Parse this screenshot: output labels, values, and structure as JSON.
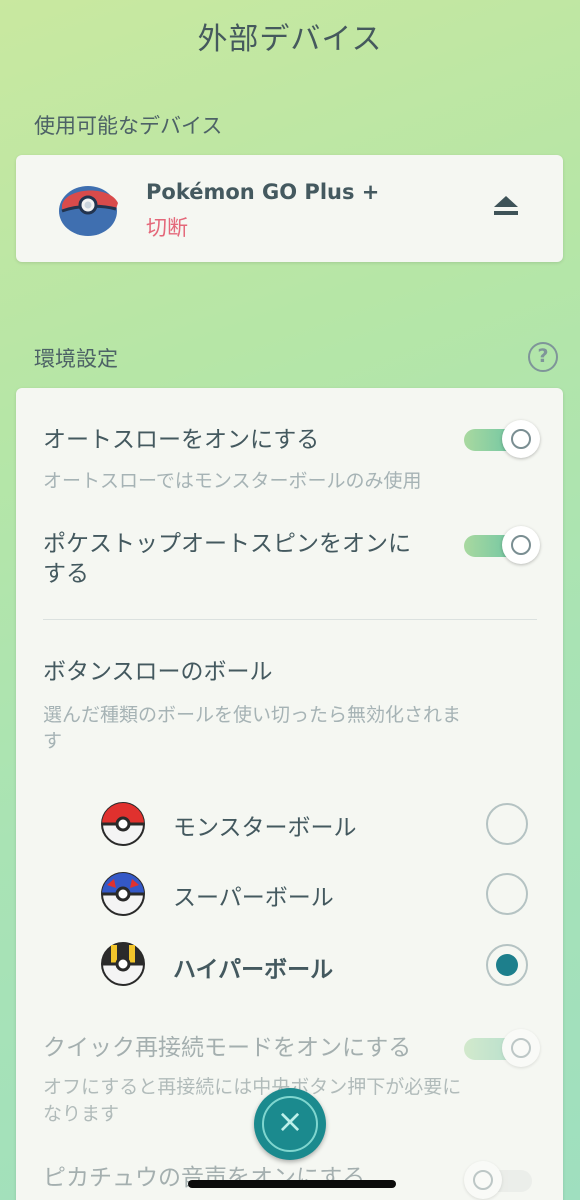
{
  "header": {
    "title": "外部デバイス"
  },
  "devices": {
    "section_label": "使用可能なデバイス",
    "device": {
      "name": "Pokémon GO Plus +",
      "status": "切断",
      "status_color": "#e4687a",
      "action_icon": "eject-icon"
    }
  },
  "settings": {
    "section_label": "環境設定",
    "help_icon": "?",
    "auto_throw": {
      "title": "オートスローをオンにする",
      "description": "オートスローではモンスターボールのみ使用",
      "enabled": true
    },
    "auto_spin": {
      "title_line1": "ポケストップオートスピンをオンに",
      "title_line2": "する",
      "enabled": true
    },
    "button_throw": {
      "title": "ボタンスローのボール",
      "description_line1": "選んだ種類のボールを使い切ったら無効化されま",
      "description_line2": "す",
      "balls": [
        {
          "label": "モンスターボール",
          "icon": "poke-ball-icon",
          "selected": false
        },
        {
          "label": "スーパーボール",
          "icon": "great-ball-icon",
          "selected": false
        },
        {
          "label": "ハイパーボール",
          "icon": "ultra-ball-icon",
          "selected": true
        }
      ]
    },
    "quick_reconnect": {
      "title": "クイック再接続モードをオンにする",
      "description_line1": "オフにすると再接続には中央ボタン押下が必要に",
      "description_line2": "なります",
      "enabled": true
    },
    "pikachu_voice": {
      "title": "ピカチュウの音声をオンにする",
      "enabled": false
    }
  },
  "footer": {
    "close_icon": "×"
  },
  "colors": {
    "accent": "#1d7f8c",
    "close_button": "#1b8a8e"
  }
}
